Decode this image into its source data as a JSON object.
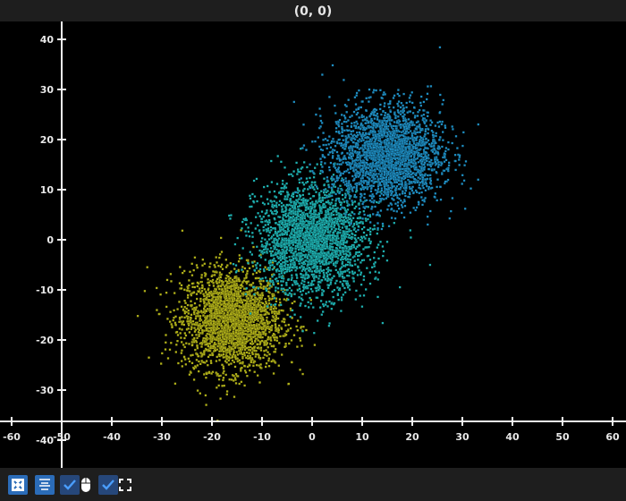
{
  "title": "(0, 0)",
  "toolbar": [
    {
      "name": "fit-icon"
    },
    {
      "name": "align-icon"
    },
    {
      "name": "checkbox-mouse",
      "checked": true,
      "icon": "mouse-icon"
    },
    {
      "name": "checkbox-fullscreen",
      "checked": true,
      "icon": "fullscreen-icon"
    }
  ],
  "chart_data": {
    "type": "scatter",
    "title": "",
    "xlabel": "",
    "ylabel": "",
    "xlim": [
      -62,
      63
    ],
    "ylim": [
      -45,
      44
    ],
    "x_ticks": [
      -60,
      -50,
      -40,
      -30,
      -20,
      -10,
      0,
      10,
      20,
      30,
      40,
      50,
      60
    ],
    "y_ticks": [
      40,
      30,
      20,
      10,
      0,
      -10,
      -20,
      -30,
      -40
    ],
    "x_axis_at_y": -36.25,
    "y_axis_at_x": -50,
    "grid": false,
    "series": [
      {
        "color": "#b3b31a",
        "center": [
          -16,
          -16
        ],
        "std": [
          5,
          5
        ],
        "count": 2500
      },
      {
        "color": "#1fb3b3",
        "center": [
          0,
          0
        ],
        "std": [
          5.5,
          5.5
        ],
        "count": 2500
      },
      {
        "color": "#1f8fc4",
        "center": [
          15,
          17
        ],
        "std": [
          5.5,
          5
        ],
        "count": 2500
      }
    ]
  }
}
